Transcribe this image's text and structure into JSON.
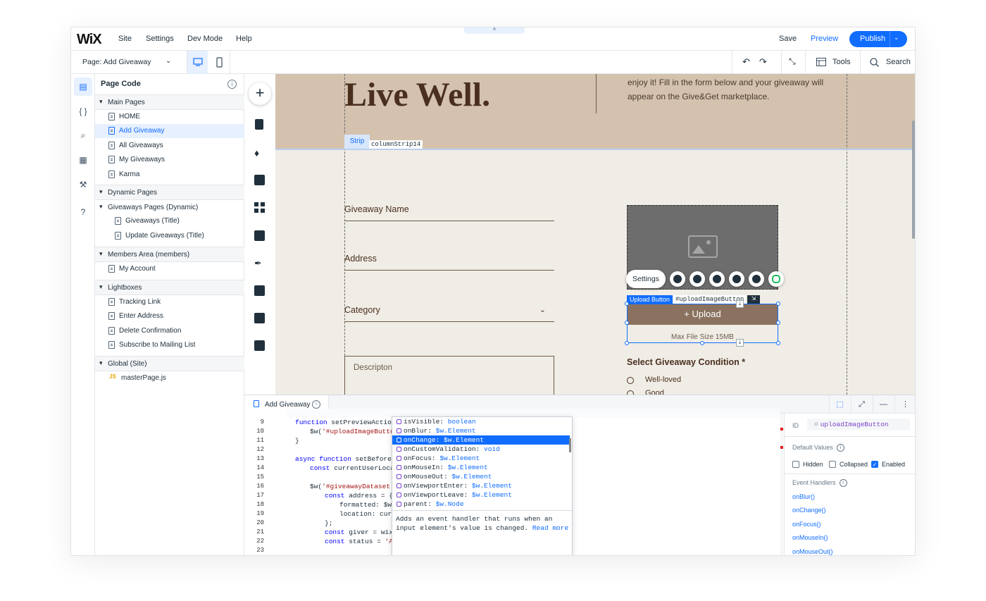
{
  "topbar": {
    "logo": "WiX",
    "menu": [
      "Site",
      "Settings",
      "Dev Mode",
      "Help"
    ],
    "pulltab": "˄",
    "save": "Save",
    "preview": "Preview",
    "publish": "Publish"
  },
  "bar2": {
    "page_label": "Page:",
    "page_value": "Add Giveaway",
    "tools": "Tools",
    "search": "Search"
  },
  "pagecode": {
    "title": "Page Code",
    "sections": {
      "main": "Main Pages",
      "dynamic": "Dynamic Pages",
      "dynamic_sub": "Giveaways Pages (Dynamic)",
      "members": "Members Area (members)",
      "lightboxes": "Lightboxes",
      "global": "Global (Site)"
    },
    "main_pages": [
      "HOME",
      "Add Giveaway",
      "All Giveaways",
      "My Giveaways",
      "Karma"
    ],
    "dynamic_pages": [
      "Giveaways (Title)",
      "Update Giveaways (Title)"
    ],
    "members_pages": [
      "My Account"
    ],
    "lightboxes": [
      "Tracking Link",
      "Enter Address",
      "Delete Confirmation",
      "Subscribe to Mailing List"
    ],
    "global_files": [
      "masterPage.js"
    ],
    "js_badge": "JS"
  },
  "canvas": {
    "hero_title": "Live Well.",
    "hero_text": "enjoy it! Fill in the form below and your giveaway will appear on the Give&Get marketplace.",
    "strip_label": "Strip",
    "strip_id": "columnStrip14",
    "fields": [
      "Giveaway Name",
      "Address",
      "Category"
    ],
    "description_placeholder": "Descripton",
    "toolbar_settings": "Settings",
    "upload_label": "Upload Button",
    "upload_id": "#uploadImageButton",
    "upload_text": "+ Upload",
    "max_size": "Max File Size 15MB",
    "condition_title": "Select Giveaway Condition *",
    "conditions": [
      "Well-loved",
      "Good"
    ]
  },
  "editor": {
    "tab": "Add Giveaway",
    "line_numbers": [
      "9",
      "10",
      "11",
      "12",
      "13",
      "14",
      "15",
      "16",
      "17",
      "18",
      "19",
      "20",
      "21",
      "22",
      "23"
    ],
    "autocomplete": [
      {
        "name": "isVisible:",
        "type": "boolean"
      },
      {
        "name": "onBlur:",
        "type": "$w.Element"
      },
      {
        "name": "onChange:",
        "type": "$w.Element"
      },
      {
        "name": "onCustomValidation:",
        "type": "void"
      },
      {
        "name": "onFocus:",
        "type": "$w.Element"
      },
      {
        "name": "onMouseIn:",
        "type": "$w.Element"
      },
      {
        "name": "onMouseOut:",
        "type": "$w.Element"
      },
      {
        "name": "onViewportEnter:",
        "type": "$w.Element"
      },
      {
        "name": "onViewportLeave:",
        "type": "$w.Element"
      },
      {
        "name": "parent:",
        "type": "$w.Node"
      }
    ],
    "ac_description": "Adds an event handler that runs when an input element's value is changed.",
    "ac_read_more": "Read more"
  },
  "props": {
    "id_label": "ID",
    "id_value": "uploadImageButton",
    "default_values": "Default Values",
    "checkboxes": [
      "Hidden",
      "Collapsed",
      "Enabled"
    ],
    "event_handlers": "Event Handlers",
    "handlers": [
      "onBlur()",
      "onChange()",
      "onFocus()",
      "onMouseIn()",
      "onMouseOut()"
    ]
  },
  "colors": {
    "accent": "#116dff",
    "hero_bg": "#d4c2ae",
    "canvas_bg": "#f0ede6",
    "upload_bg": "#8b7260"
  }
}
